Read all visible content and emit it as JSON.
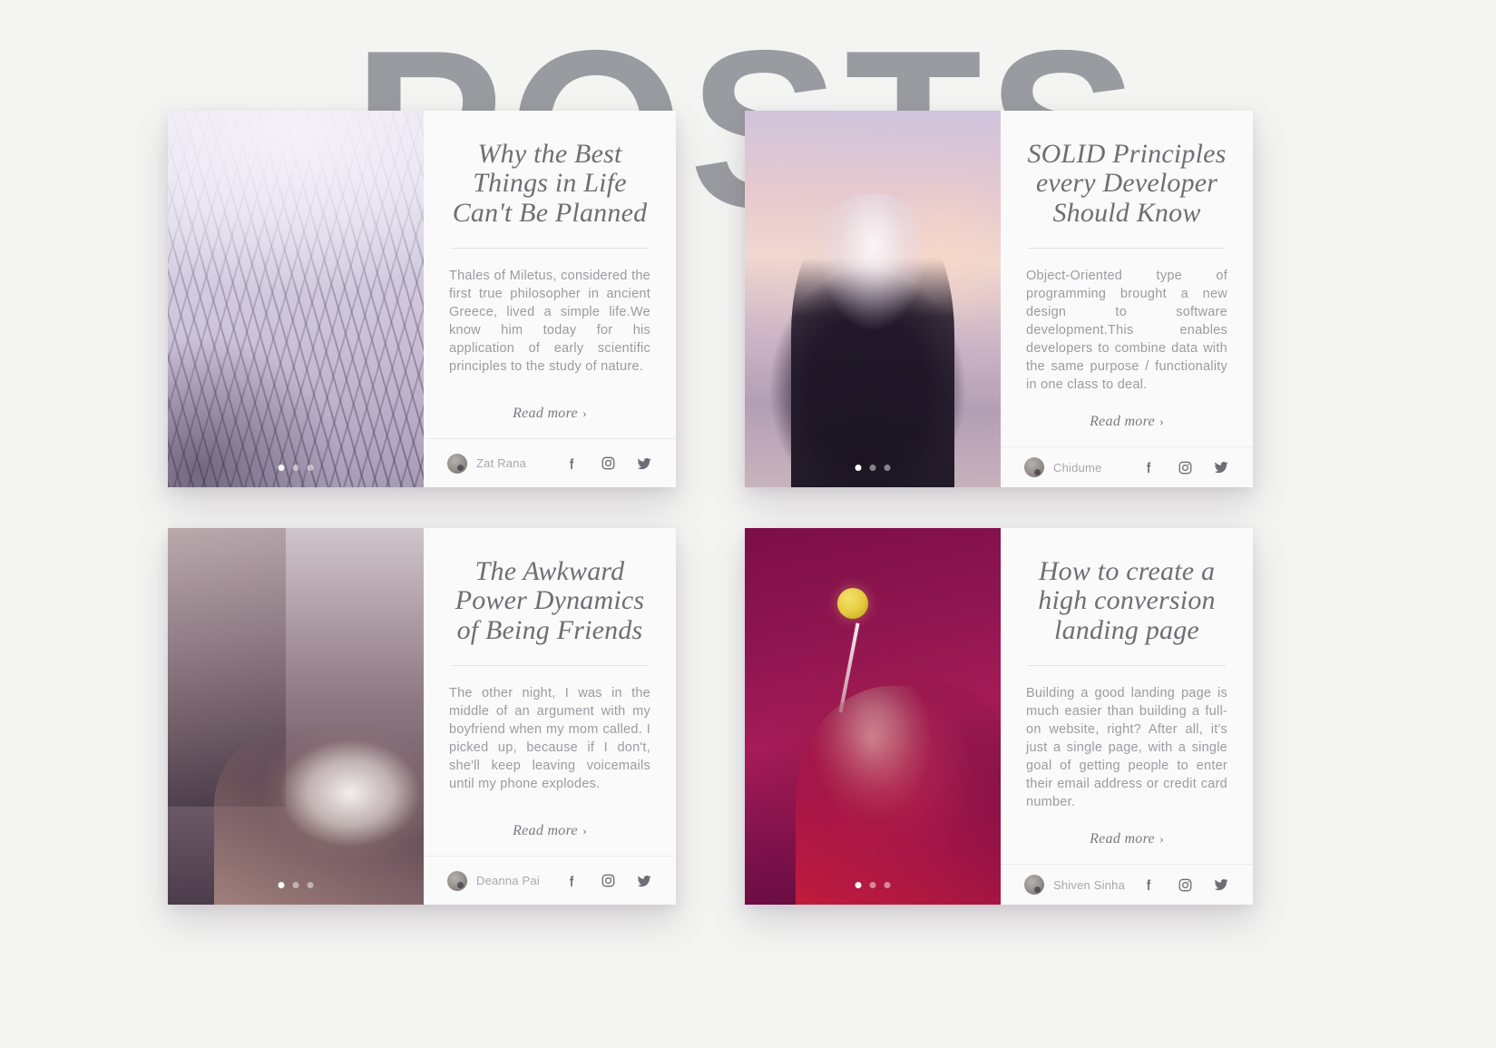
{
  "background": {
    "watermark_text": "POSTS",
    "watermark_color": "#9a9ba0",
    "page_background": "#f4f4f3"
  },
  "theme": {
    "card_background": "#fbfafa",
    "title_color": "#6e6e74",
    "body_text_color": "#9d9aa0",
    "divider_color": "#e3e1e3",
    "icon_color": "#6f6d73",
    "author_color": "#a9a6ab"
  },
  "cards": [
    {
      "id": "card-1",
      "title": "Why the Best Things in Life Can't Be Planned",
      "excerpt": "Thales of Miletus, considered the first true philosopher in ancient Greece, lived a simple life.We know him today for his application of early scientific principles to the study of nature.",
      "read_more_label": "Read more",
      "read_more_chevron": "›",
      "author": "Zat Rana",
      "image_alt": "glass-skyscraper-photo",
      "carousel": {
        "total": 3,
        "active_index": 0
      },
      "socials": [
        {
          "name": "facebook-icon",
          "label": "Facebook"
        },
        {
          "name": "instagram-icon",
          "label": "Instagram"
        },
        {
          "name": "twitter-icon",
          "label": "Twitter"
        }
      ]
    },
    {
      "id": "card-2",
      "title": "SOLID Principles every Developer Should Know",
      "excerpt": "Object-Oriented type of programming brought a new design to software development.This enables developers to combine data with the same purpose / functionality in one class to deal.",
      "read_more_label": "Read more",
      "read_more_chevron": "›",
      "author": "Chidume",
      "image_alt": "person-in-cap-at-sunset-beach-photo",
      "carousel": {
        "total": 3,
        "active_index": 0
      },
      "socials": [
        {
          "name": "facebook-icon",
          "label": "Facebook"
        },
        {
          "name": "instagram-icon",
          "label": "Instagram"
        },
        {
          "name": "twitter-icon",
          "label": "Twitter"
        }
      ]
    },
    {
      "id": "card-3",
      "title": "The Awkward Power Dynamics of Being Friends",
      "excerpt": "The other night, I was in the middle of an argument with my boyfriend when my mom called. I picked up, because if I don't, she'll keep leaving voicemails until my phone explodes.",
      "read_more_label": "Read more",
      "read_more_chevron": "›",
      "author": "Deanna Pai",
      "image_alt": "hand-holding-coffee-cup-on-street-photo",
      "carousel": {
        "total": 3,
        "active_index": 0
      },
      "socials": [
        {
          "name": "facebook-icon",
          "label": "Facebook"
        },
        {
          "name": "instagram-icon",
          "label": "Instagram"
        },
        {
          "name": "twitter-icon",
          "label": "Twitter"
        }
      ]
    },
    {
      "id": "card-4",
      "title": "How to create a high conversion landing page",
      "excerpt": "Building a good landing page is much easier than building a full-on website, right? After all, it's just a single page, with a single goal of getting people to enter their email address or credit card number.",
      "read_more_label": "Read more",
      "read_more_chevron": "›",
      "author": "Shiven Sinha",
      "image_alt": "hand-holding-lollipop-on-magenta-photo",
      "carousel": {
        "total": 3,
        "active_index": 0
      },
      "socials": [
        {
          "name": "facebook-icon",
          "label": "Facebook"
        },
        {
          "name": "instagram-icon",
          "label": "Instagram"
        },
        {
          "name": "twitter-icon",
          "label": "Twitter"
        }
      ]
    }
  ]
}
